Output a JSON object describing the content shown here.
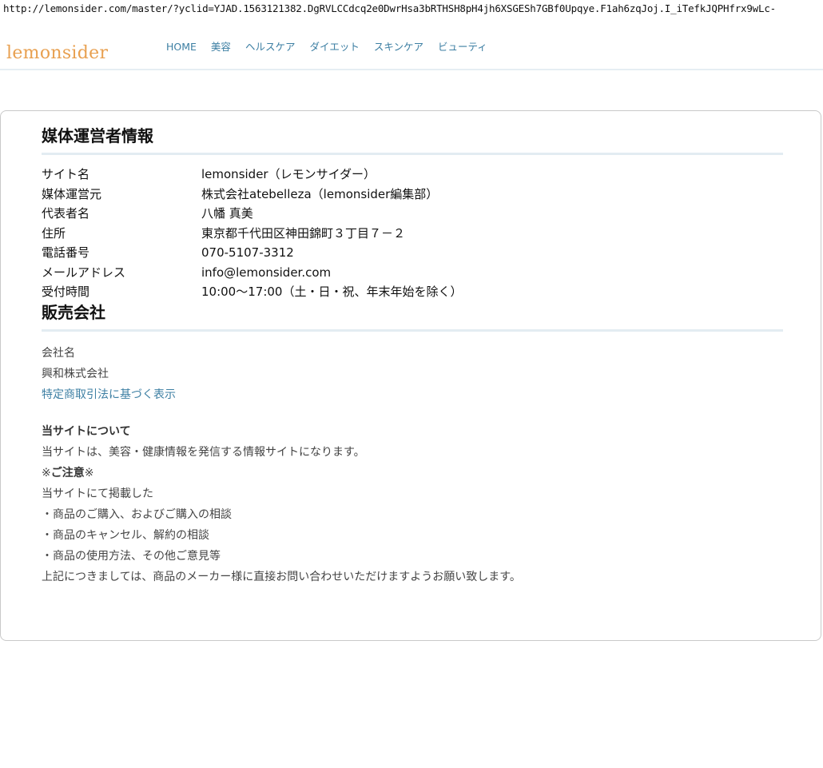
{
  "url": "http://lemonsider.com/master/?yclid=YJAD.1563121382.DgRVLCCdcq2e0DwrHsa3bRTHSH8pH4jh6XSGESh7GBf0Upqye.F1ah6zqJoj.I_iTefkJQPHfrx9wLc-",
  "header": {
    "logo": "lemonsider",
    "nav": [
      "HOME",
      "美容",
      "ヘルスケア",
      "ダイエット",
      "スキンケア",
      "ビューティ"
    ]
  },
  "operator": {
    "title": "媒体運営者情報",
    "rows": [
      {
        "label": "サイト名",
        "value": "lemonsider（レモンサイダー）"
      },
      {
        "label": "媒体運営元",
        "value": "株式会社atebelleza（lemonsider編集部）"
      },
      {
        "label": "代表者名",
        "value": "八幡 真美"
      },
      {
        "label": "住所",
        "value": "東京都千代田区神田錦町３丁目７－２"
      },
      {
        "label": "電話番号",
        "value": "070-5107-3312"
      },
      {
        "label": "メールアドレス",
        "value": "info@lemonsider.com"
      },
      {
        "label": "受付時間",
        "value": "10:00～17:00（土・日・祝、年末年始を除く）"
      }
    ]
  },
  "seller": {
    "title": "販売会社",
    "company_label": "会社名",
    "company_name": "興和株式会社",
    "law_link": "特定商取引法に基づく表示"
  },
  "about": {
    "heading": "当サイトについて",
    "description": "当サイトは、美容・健康情報を発信する情報サイトになります。",
    "notice_prefix": "※",
    "notice_bold": "ご注意",
    "notice_suffix": "※",
    "lines": [
      "当サイトにて掲載した",
      "・商品のご購入、およびご購入の相談",
      "・商品のキャンセル、解約の相談",
      "・商品の使用方法、その他ご意見等",
      "上記につきましては、商品のメーカー様に直接お問い合わせいただけますようお願い致します。"
    ]
  }
}
